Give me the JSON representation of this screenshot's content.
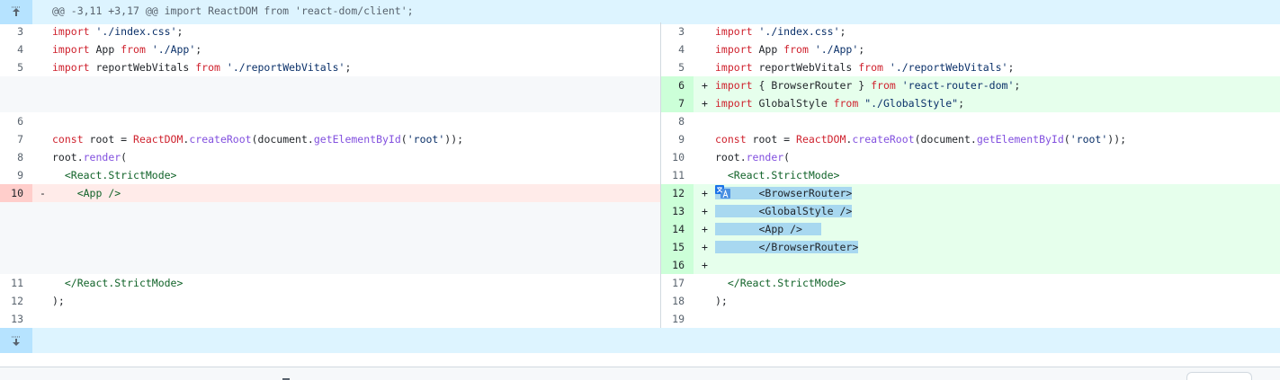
{
  "hunk_header": "@@ -3,11 +3,17 @@ import ReactDOM from 'react-dom/client';",
  "icons": {
    "expand_up": "fold-up-icon",
    "expand_down": "fold-down-icon",
    "translate": "translate-icon"
  },
  "colors": {
    "hunk_bg": "#ddf4ff",
    "addition_bg": "#e6ffec",
    "addition_num_bg": "#ccffd8",
    "deletion_bg": "#ffebe9",
    "deletion_num_bg": "#ffcecb",
    "keyword": "#cf222e",
    "string": "#0a3069",
    "function": "#8250df",
    "selection": "#a8d8f0"
  },
  "left": {
    "lines": [
      {
        "num": "3",
        "marker": "",
        "tokens": [
          [
            "kw",
            "import"
          ],
          [
            "plain",
            " "
          ],
          [
            "str",
            "'./index.css'"
          ],
          [
            "plain",
            ";"
          ]
        ]
      },
      {
        "num": "4",
        "marker": "",
        "tokens": [
          [
            "kw",
            "import"
          ],
          [
            "plain",
            " App "
          ],
          [
            "kw",
            "from"
          ],
          [
            "plain",
            " "
          ],
          [
            "str",
            "'./App'"
          ],
          [
            "plain",
            ";"
          ]
        ]
      },
      {
        "num": "5",
        "marker": "",
        "tokens": [
          [
            "kw",
            "import"
          ],
          [
            "plain",
            " reportWebVitals "
          ],
          [
            "kw",
            "from"
          ],
          [
            "plain",
            " "
          ],
          [
            "str",
            "'./reportWebVitals'"
          ],
          [
            "plain",
            ";"
          ]
        ]
      },
      {
        "num": "6",
        "marker": "",
        "tokens": []
      },
      {
        "num": "7",
        "marker": "",
        "tokens": [
          [
            "kw",
            "const"
          ],
          [
            "plain",
            " root = "
          ],
          [
            "kw",
            "ReactDOM"
          ],
          [
            "plain",
            "."
          ],
          [
            "fn",
            "createRoot"
          ],
          [
            "plain",
            "(document."
          ],
          [
            "fn",
            "getElementById"
          ],
          [
            "plain",
            "("
          ],
          [
            "str",
            "'root'"
          ],
          [
            "plain",
            "));"
          ]
        ]
      },
      {
        "num": "8",
        "marker": "",
        "tokens": [
          [
            "plain",
            "root."
          ],
          [
            "fn",
            "render"
          ],
          [
            "plain",
            "("
          ]
        ]
      },
      {
        "num": "9",
        "marker": "",
        "tokens": [
          [
            "plain",
            "  "
          ],
          [
            "tag",
            "<React.StrictMode>"
          ]
        ]
      },
      {
        "num": "10",
        "marker": "-",
        "tokens": [
          [
            "plain",
            "    "
          ],
          [
            "tag",
            "<App />"
          ]
        ]
      },
      {
        "num": "11",
        "marker": "",
        "tokens": [
          [
            "plain",
            "  "
          ],
          [
            "tag",
            "</React.StrictMode>"
          ]
        ]
      },
      {
        "num": "12",
        "marker": "",
        "tokens": [
          [
            "plain",
            ");"
          ]
        ]
      },
      {
        "num": "13",
        "marker": "",
        "tokens": []
      }
    ]
  },
  "right": {
    "lines": [
      {
        "num": "3",
        "marker": "",
        "tokens": [
          [
            "kw",
            "import"
          ],
          [
            "plain",
            " "
          ],
          [
            "str",
            "'./index.css'"
          ],
          [
            "plain",
            ";"
          ]
        ]
      },
      {
        "num": "4",
        "marker": "",
        "tokens": [
          [
            "kw",
            "import"
          ],
          [
            "plain",
            " App "
          ],
          [
            "kw",
            "from"
          ],
          [
            "plain",
            " "
          ],
          [
            "str",
            "'./App'"
          ],
          [
            "plain",
            ";"
          ]
        ]
      },
      {
        "num": "5",
        "marker": "",
        "tokens": [
          [
            "kw",
            "import"
          ],
          [
            "plain",
            " reportWebVitals "
          ],
          [
            "kw",
            "from"
          ],
          [
            "plain",
            " "
          ],
          [
            "str",
            "'./reportWebVitals'"
          ],
          [
            "plain",
            ";"
          ]
        ]
      },
      {
        "num": "6",
        "marker": "+",
        "tokens": [
          [
            "kw",
            "import"
          ],
          [
            "plain",
            " { BrowserRouter } "
          ],
          [
            "kw",
            "from"
          ],
          [
            "plain",
            " "
          ],
          [
            "str",
            "'react-router-dom'"
          ],
          [
            "plain",
            ";"
          ]
        ]
      },
      {
        "num": "7",
        "marker": "+",
        "tokens": [
          [
            "kw",
            "import"
          ],
          [
            "plain",
            " GlobalStyle "
          ],
          [
            "kw",
            "from"
          ],
          [
            "plain",
            " "
          ],
          [
            "str",
            "\"./GlobalStyle\""
          ],
          [
            "plain",
            ";"
          ]
        ]
      },
      {
        "num": "8",
        "marker": "",
        "tokens": []
      },
      {
        "num": "9",
        "marker": "",
        "tokens": [
          [
            "kw",
            "const"
          ],
          [
            "plain",
            " root = "
          ],
          [
            "kw",
            "ReactDOM"
          ],
          [
            "plain",
            "."
          ],
          [
            "fn",
            "createRoot"
          ],
          [
            "plain",
            "(document."
          ],
          [
            "fn",
            "getElementById"
          ],
          [
            "plain",
            "("
          ],
          [
            "str",
            "'root'"
          ],
          [
            "plain",
            "));"
          ]
        ]
      },
      {
        "num": "10",
        "marker": "",
        "tokens": [
          [
            "plain",
            "root."
          ],
          [
            "fn",
            "render"
          ],
          [
            "plain",
            "("
          ]
        ]
      },
      {
        "num": "11",
        "marker": "",
        "tokens": [
          [
            "plain",
            "  "
          ],
          [
            "tag",
            "<React.StrictMode>"
          ]
        ]
      },
      {
        "num": "12",
        "marker": "+",
        "tokens": [
          [
            "sel",
            "       "
          ],
          [
            "sel",
            "<BrowserRouter>"
          ]
        ]
      },
      {
        "num": "13",
        "marker": "+",
        "tokens": [
          [
            "sel",
            "       "
          ],
          [
            "sel",
            "<GlobalStyle />"
          ]
        ]
      },
      {
        "num": "14",
        "marker": "+",
        "tokens": [
          [
            "sel",
            "       "
          ],
          [
            "sel",
            "<App />"
          ],
          [
            "sel",
            "   "
          ]
        ]
      },
      {
        "num": "15",
        "marker": "+",
        "tokens": [
          [
            "sel",
            "       "
          ],
          [
            "sel",
            "</BrowserRouter>"
          ]
        ]
      },
      {
        "num": "16",
        "marker": "+",
        "tokens": []
      },
      {
        "num": "17",
        "marker": "",
        "tokens": [
          [
            "plain",
            "  "
          ],
          [
            "tag",
            "</React.StrictMode>"
          ]
        ]
      },
      {
        "num": "18",
        "marker": "",
        "tokens": [
          [
            "plain",
            ");"
          ]
        ]
      },
      {
        "num": "19",
        "marker": "",
        "tokens": []
      }
    ]
  }
}
